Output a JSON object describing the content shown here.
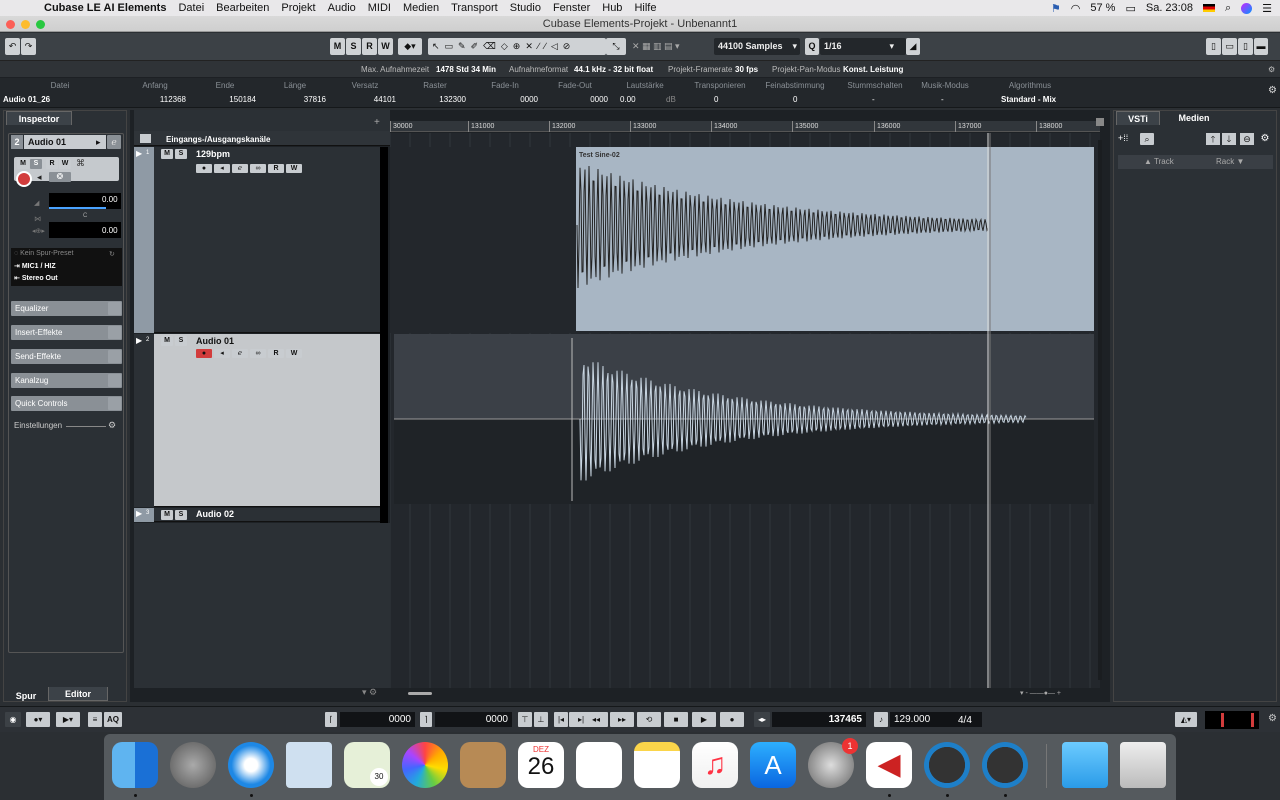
{
  "menubar": {
    "app": "Cubase LE AI Elements",
    "items": [
      "Datei",
      "Bearbeiten",
      "Projekt",
      "Audio",
      "MIDI",
      "Medien",
      "Transport",
      "Studio",
      "Fenster",
      "Hub",
      "Hilfe"
    ],
    "battery": "57 %",
    "clock": "Sa. 23:08"
  },
  "window": {
    "title": "Cubase Elements-Projekt - Unbenannt1"
  },
  "toolbar": {
    "mode_buttons": [
      "M",
      "S",
      "R",
      "W"
    ],
    "samples": "44100 Samples",
    "quantize_label": "Q",
    "quantize": "1/16"
  },
  "status": {
    "rec_time_label": "Max. Aufnahmezeit",
    "rec_time": "1478 Std 34 Min",
    "rec_format_label": "Aufnahmeformat",
    "rec_format": "44.1 kHz - 32 bit float",
    "framerate_label": "Projekt-Framerate",
    "framerate": "30 fps",
    "pan_label": "Projekt-Pan-Modus",
    "pan": "Konst. Leistung"
  },
  "infoline": {
    "labels": [
      "Datei",
      "Anfang",
      "Ende",
      "Länge",
      "Versatz",
      "Raster",
      "Fade-In",
      "Fade-Out",
      "Lautstärke",
      "Transponieren",
      "Feinabstimmung",
      "Stummschalten",
      "Musik-Modus",
      "Algorithmus"
    ],
    "values": [
      "Audio 01_26",
      "112368",
      "150184",
      "37816",
      "44101",
      "132300",
      "0000",
      "0000",
      "0.00",
      "0",
      "0",
      "-",
      "-",
      "Standard - Mix"
    ],
    "db_unit": "dB"
  },
  "inspector": {
    "tab": "Inspector",
    "track_number": "2",
    "track_name": "Audio 01",
    "buttons": [
      "M",
      "S",
      "R",
      "W"
    ],
    "vol": "0.00",
    "pan_letter": "C",
    "pan": "0.00",
    "preset": "Kein Spur-Preset",
    "input": "MIC1 / HIZ",
    "output": "Stereo Out",
    "sections": [
      "Equalizer",
      "Insert-Effekte",
      "Send-Effekte",
      "Kanalzug",
      "Quick Controls"
    ],
    "settings": "Einstellungen",
    "bottom_tabs": [
      "Spur",
      "Editor"
    ]
  },
  "project": {
    "io_label": "Eingangs-/Ausgangskanäle",
    "tracks": [
      {
        "num": "1",
        "name": "129bpm"
      },
      {
        "num": "2",
        "name": "Audio 01"
      },
      {
        "num": "3",
        "name": "Audio 02"
      }
    ],
    "ms": [
      "M",
      "S"
    ],
    "rw": [
      "R",
      "W"
    ],
    "ruler": [
      "30000",
      "131000",
      "132000",
      "133000",
      "134000",
      "135000",
      "136000",
      "137000",
      "138000"
    ],
    "event_name": "Test Sine-02"
  },
  "vsti": {
    "tabs": [
      "VSTi",
      "Medien"
    ],
    "track": "Track",
    "rack": "Rack"
  },
  "transport": {
    "left_pos": "0000",
    "right_pos": "0000",
    "aq": "AQ",
    "position": "137465",
    "tempo": "129.000",
    "signature": "4/4"
  },
  "dock": {
    "calendar_month": "DEZ",
    "calendar_day": "26",
    "badge": "1",
    "reminders_badge": "30"
  },
  "colors": {
    "accent": "#d23c3c",
    "event_fill": "#a8b6c4",
    "track_sel": "#c5c8cb"
  }
}
